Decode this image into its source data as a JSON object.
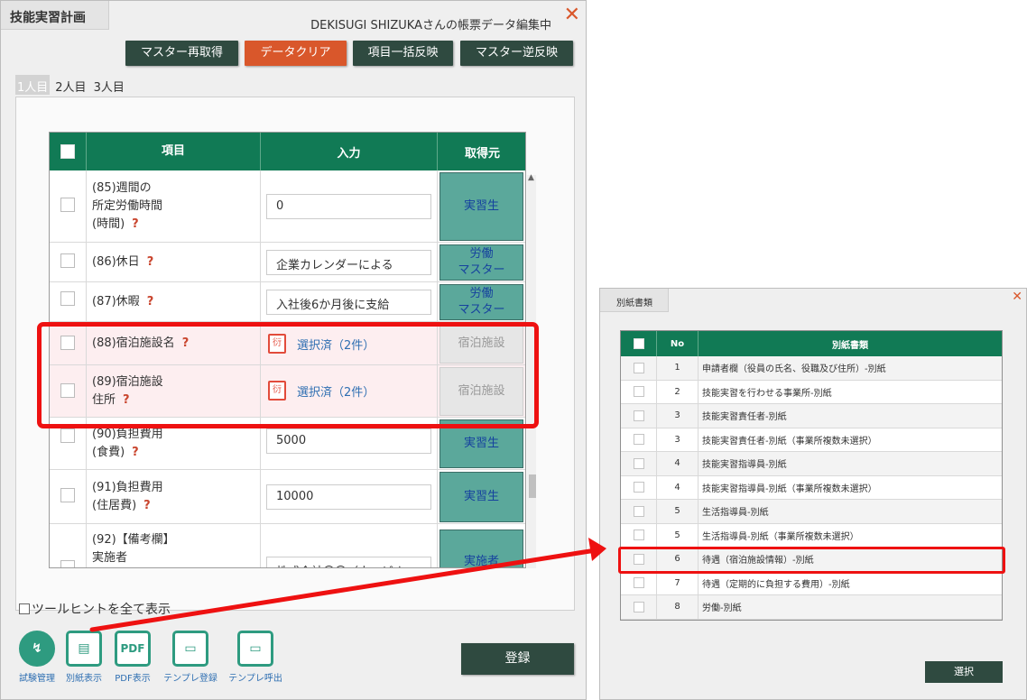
{
  "main": {
    "title": "技能実習計画",
    "status": "DEKISUGI SHIZUKAさんの帳票データ編集中",
    "close_glyph": "✕",
    "toolbar": {
      "master_refetch": "マスター再取得",
      "data_clear": "データクリア",
      "bulk_apply": "項目一括反映",
      "master_reverse": "マスター逆反映"
    },
    "person_tabs": [
      "1人目",
      "2人目",
      "3人目"
    ],
    "table": {
      "headers": {
        "item": "項目",
        "input": "入力",
        "source": "取得元"
      },
      "rows": [
        {
          "item": [
            "(85)週間の",
            "所定労働時間",
            "(時間)"
          ],
          "input": "0",
          "source": "実習生"
        },
        {
          "item": [
            "(86)休日"
          ],
          "input": "企業カレンダーによる",
          "source": [
            "労働",
            "マスター"
          ]
        },
        {
          "item": [
            "(87)休暇"
          ],
          "input": "入社後6か月後に支給",
          "source": [
            "労働",
            "マスター"
          ]
        },
        {
          "item": [
            "(88)宿泊施設名"
          ],
          "input": "選択済（2件）",
          "source": "宿泊施設"
        },
        {
          "item": [
            "(89)宿泊施設",
            "住所"
          ],
          "input": "選択済（2件）",
          "source": "宿泊施設"
        },
        {
          "item": [
            "(90)負担費用",
            "(食費)"
          ],
          "input": "5000",
          "source": "実習生"
        },
        {
          "item": [
            "(91)負担費用",
            "(住居費)"
          ],
          "input": "10000",
          "source": "実習生"
        },
        {
          "item": [
            "(92)【備考欄】",
            "実施者"
          ],
          "input": "株式会社〇〇（ウェビナー",
          "source": "実施者"
        }
      ],
      "help_mark": "?",
      "doc_icon_glyph": "衍"
    },
    "tooltip_toggle": "ツールヒントを全て表示",
    "tools": [
      {
        "icon": "exam-management-icon",
        "glyph": "↯",
        "label": "試験管理"
      },
      {
        "icon": "attachment-view-icon",
        "glyph": "▤",
        "label": "別紙表示"
      },
      {
        "icon": "pdf-view-icon",
        "glyph": "PDF",
        "label": "PDF表示"
      },
      {
        "icon": "template-register-icon",
        "glyph": "▭",
        "label": "テンプレ登録"
      },
      {
        "icon": "template-load-icon",
        "glyph": "▭",
        "label": "テンプレ呼出"
      }
    ],
    "register": "登録"
  },
  "attachment": {
    "title": "別紙書類",
    "close_glyph": "✕",
    "headers": {
      "no": "No",
      "name": "別紙書類"
    },
    "rows": [
      {
        "no": "1",
        "name": "申請者欄（役員の氏名、役職及び住所）-別紙"
      },
      {
        "no": "2",
        "name": "技能実習を行わせる事業所-別紙"
      },
      {
        "no": "3",
        "name": "技能実習責任者-別紙"
      },
      {
        "no": "3",
        "name": "技能実習責任者-別紙（事業所複数未選択）"
      },
      {
        "no": "4",
        "name": "技能実習指導員-別紙"
      },
      {
        "no": "4",
        "name": "技能実習指導員-別紙（事業所複数未選択）"
      },
      {
        "no": "5",
        "name": "生活指導員-別紙"
      },
      {
        "no": "5",
        "name": "生活指導員-別紙（事業所複数未選択）"
      },
      {
        "no": "6",
        "name": "待遇（宿泊施設情報）-別紙"
      },
      {
        "no": "7",
        "name": "待遇（定期的に負担する費用）-別紙"
      },
      {
        "no": "8",
        "name": "労働-別紙"
      }
    ],
    "select": "選択"
  },
  "colors": {
    "header_green": "#117a55",
    "dark_button": "#2f4a40",
    "accent_orange": "#d9572b",
    "highlight_red": "#ee1111"
  }
}
